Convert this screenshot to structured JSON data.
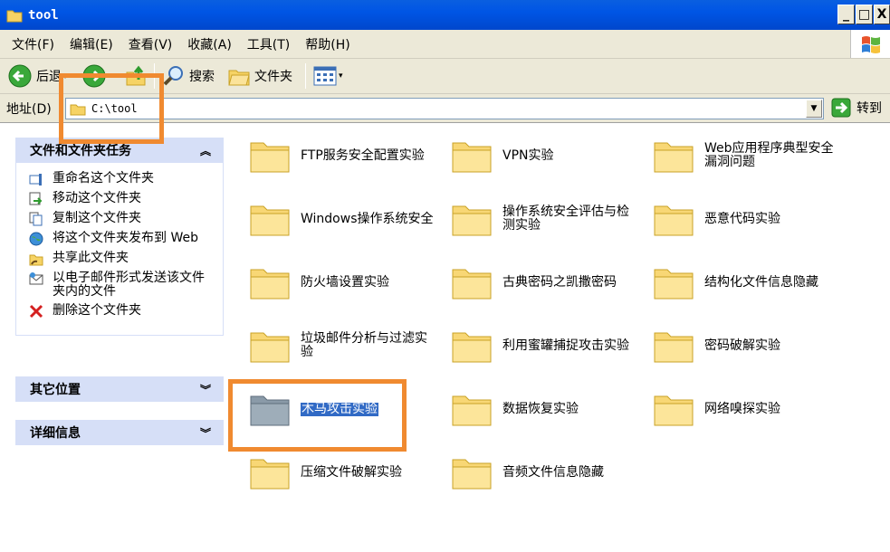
{
  "window": {
    "title": "tool",
    "min": "_",
    "max": "□",
    "close": "X"
  },
  "menu": [
    "文件(F)",
    "编辑(E)",
    "查看(V)",
    "收藏(A)",
    "工具(T)",
    "帮助(H)"
  ],
  "toolbar": {
    "back": "后退",
    "search": "搜索",
    "folders": "文件夹"
  },
  "address": {
    "label": "地址(D)",
    "value": "C:\\tool",
    "go": "转到"
  },
  "left": {
    "tasks_title": "文件和文件夹任务",
    "tasks": [
      {
        "icon": "rename-icon",
        "label": "重命名这个文件夹"
      },
      {
        "icon": "move-icon",
        "label": "移动这个文件夹"
      },
      {
        "icon": "copy-icon",
        "label": "复制这个文件夹"
      },
      {
        "icon": "publish-web-icon",
        "label": "将这个文件夹发布到 Web"
      },
      {
        "icon": "share-icon",
        "label": "共享此文件夹"
      },
      {
        "icon": "email-icon",
        "label": "以电子邮件形式发送该文件夹内的文件"
      },
      {
        "icon": "delete-icon",
        "label": "删除这个文件夹"
      }
    ],
    "other_title": "其它位置",
    "details_title": "详细信息"
  },
  "folders": [
    "FTP服务安全配置实验",
    "VPN实验",
    "Web应用程序典型安全漏洞问题",
    "Windows操作系统安全",
    "操作系统安全评估与检测实验",
    "恶意代码实验",
    "防火墙设置实验",
    "古典密码之凯撒密码",
    "结构化文件信息隐藏",
    "垃圾邮件分析与过滤实验",
    "利用蜜罐捕捉攻击实验",
    "密码破解实验",
    "木马攻击实验",
    "数据恢复实验",
    "网络嗅探实验",
    "压缩文件破解实验",
    "音频文件信息隐藏"
  ],
  "selected_folder": "木马攻击实验",
  "colors": {
    "titlebar": "#0055e5",
    "panel_header": "#d6dff7",
    "highlight": "#f08a30",
    "selection": "#316ac5"
  }
}
